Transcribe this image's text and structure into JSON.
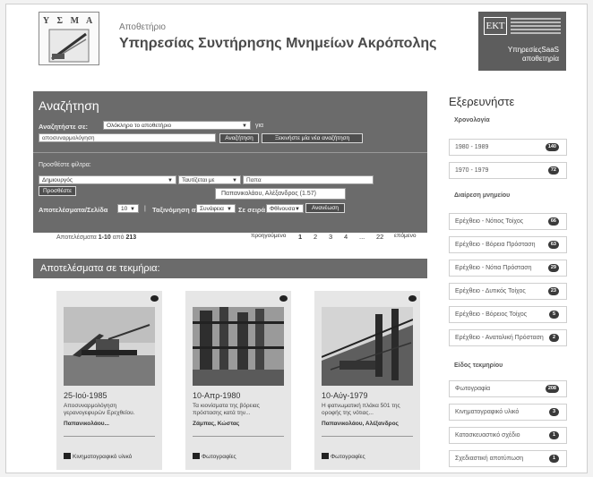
{
  "header": {
    "logo_text": "Υ Σ Μ Α",
    "subtitle": "Αποθετήριο",
    "title": "Υπηρεσίας Συντήρησης Μνημείων Ακρόπολης",
    "partner_logo_text": "ΕΚΤ",
    "partner_name_line1": "Υπηρεσίες",
    "partner_name_highlight": "SaaS",
    "partner_name_line2": "αποθετηρία"
  },
  "search": {
    "heading": "Αναζήτηση",
    "search_in_label": "Αναζητήστε σε:",
    "scope_value": "Ολόκληρο το αποθετήριο",
    "for_label": "για",
    "query_value": "αποσυναρμολόγηση",
    "search_button": "Αναζήτηση",
    "new_search_button": "Ξεκινήστε μία νέα αναζήτηση",
    "filters_label": "Προσθέστε φίλτρα:",
    "filter_field": "Δημιουργός",
    "filter_op": "Ταυτίζεται με",
    "filter_value": "Παπα",
    "add_button": "Προσθέστε",
    "suggestion": "Παπανικολάου, Αλέξανδρος (1.57)",
    "rpp_label": "Αποτελέσματα/Σελίδα",
    "rpp_value": "10",
    "sort_label": "Ταξινόμηση ανά",
    "sort_value": "Συνάφεια",
    "order_label": "Σε σειρά",
    "order_value": "Φθίνουσα",
    "update_button": "Ανανέωση"
  },
  "pagination": {
    "summary_prefix": "Αποτελέσματα",
    "range": "1-10",
    "of": "από",
    "total": "213",
    "prev": "προηγούμενο",
    "pages": [
      "1",
      "2",
      "3",
      "4",
      "...",
      "22"
    ],
    "next": "επόμενο"
  },
  "results_heading": "Αποτελέσματα σε τεκμήρια:",
  "cards": [
    {
      "date": "25-Ιού-1985",
      "title": "Αποσυναρμολόγηση γερανογεφυρών Ερεχθείου.",
      "author": "Παπανικολάου...",
      "type": "Κινηματογραφικό υλικό",
      "type_icon": "video-camera-icon"
    },
    {
      "date": "10-Απρ-1980",
      "title": "Τα κιονίσματα της βόρειας πρόστασης κατά την...",
      "author": "Ζάμπας, Κώστας",
      "type": "Φωτογραφίες",
      "type_icon": "photo-icon"
    },
    {
      "date": "10-Αύγ-1979",
      "title": "Η φατνωματική πλάκα 501 της οροφής της νότιας...",
      "author": "Παπανικολάου, Αλέξανδρος",
      "type": "Φωτογραφίες",
      "type_icon": "photo-icon"
    }
  ],
  "sidebar": {
    "title": "Εξερευνήστε",
    "sections": [
      {
        "heading": "Χρονολογία",
        "items": [
          {
            "label": "1980 - 1989",
            "count": "140"
          },
          {
            "label": "1970 - 1979",
            "count": "72"
          }
        ]
      },
      {
        "heading": "Διαίρεση μνημείου",
        "items": [
          {
            "label": "Ερέχθειο - Νότιος Τοίχος",
            "count": "66"
          },
          {
            "label": "Ερέχθειο - Βόρεια Πρόσταση",
            "count": "63"
          },
          {
            "label": "Ερέχθειο - Νότια Πρόσταση",
            "count": "29"
          },
          {
            "label": "Ερέχθειο - Δυτικός Τοίχος",
            "count": "23"
          },
          {
            "label": "Ερέχθειο - Βόρειος Τοίχος",
            "count": "5"
          },
          {
            "label": "Ερέχθειο - Ανατολική Πρόσταση",
            "count": "2"
          }
        ]
      },
      {
        "heading": "Είδος τεκμηρίου",
        "items": [
          {
            "label": "Φωτογραφία",
            "count": "208"
          },
          {
            "label": "Κινηματογραφικό υλικό",
            "count": "3"
          },
          {
            "label": "Κατασκευαστικό σχέδιο",
            "count": "1"
          },
          {
            "label": "Σχεδιαστική αποτύπωση",
            "count": "1"
          }
        ]
      }
    ]
  }
}
